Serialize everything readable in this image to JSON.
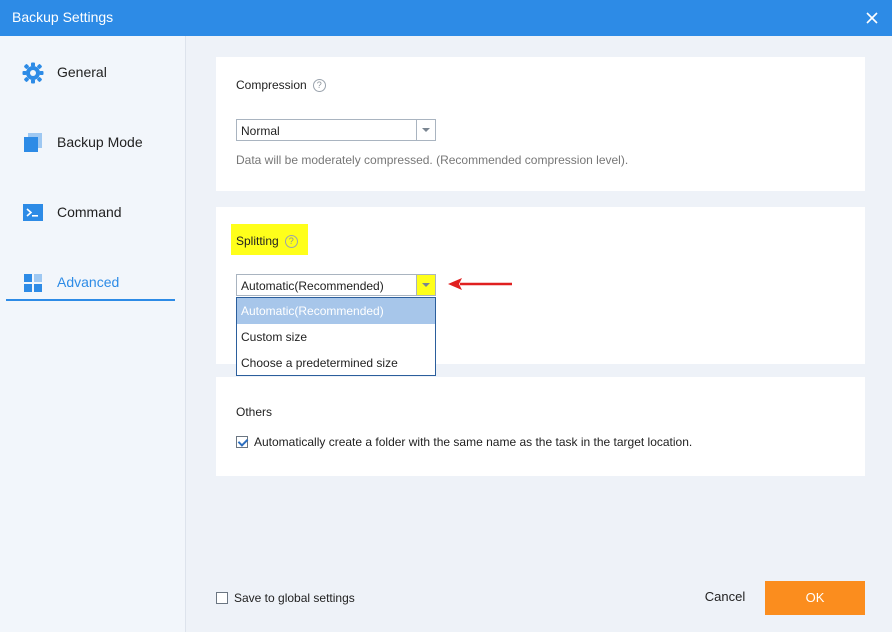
{
  "window": {
    "title": "Backup Settings"
  },
  "sidebar": {
    "items": [
      {
        "label": "General",
        "icon": "gear-icon"
      },
      {
        "label": "Backup Mode",
        "icon": "copy-icon"
      },
      {
        "label": "Command",
        "icon": "terminal-icon"
      },
      {
        "label": "Advanced",
        "icon": "grid-icon",
        "active": true
      }
    ]
  },
  "compression": {
    "title": "Compression",
    "help": "?",
    "selected": "Normal",
    "hint": "Data will be moderately compressed. (Recommended compression level)."
  },
  "splitting": {
    "title": "Splitting",
    "help": "?",
    "selected": "Automatic(Recommended)",
    "options": [
      "Automatic(Recommended)",
      "Custom size",
      "Choose a predetermined size"
    ],
    "highlighted_option": "Automatic(Recommended)"
  },
  "others": {
    "title": "Others",
    "checkbox_label": "Automatically create a folder with the same name as the task in the target location.",
    "checked": true
  },
  "footer": {
    "save_global_label": "Save to global settings",
    "save_global_checked": false,
    "cancel_label": "Cancel",
    "ok_label": "OK"
  },
  "colors": {
    "accent": "#2d8be6",
    "ok_button": "#fb8d1e",
    "highlight": "#ffff1a",
    "annotation_arrow": "#e02020"
  }
}
